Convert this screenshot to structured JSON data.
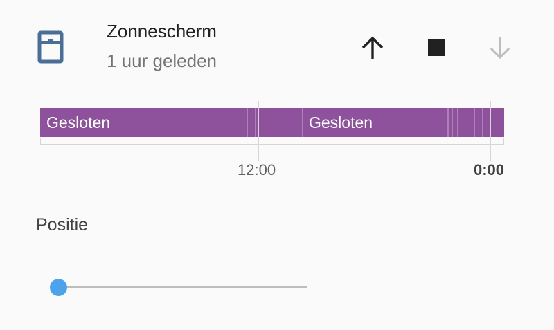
{
  "entity": {
    "name": "Zonnescherm",
    "last_changed": "1 uur geleden",
    "icon": "window-shutter-icon"
  },
  "controls": {
    "open": {
      "icon": "arrow-up-icon",
      "enabled": true
    },
    "stop": {
      "icon": "stop-icon",
      "enabled": true
    },
    "close": {
      "icon": "arrow-down-icon",
      "enabled": false
    }
  },
  "history": {
    "color": "#8e519b",
    "segments": [
      {
        "label": "Gesloten"
      },
      {
        "label": "Gesloten"
      }
    ],
    "axis": {
      "ticks": [
        {
          "label": "12:00",
          "bold": false
        },
        {
          "label": "0:00",
          "bold": true
        }
      ]
    }
  },
  "position": {
    "label": "Positie",
    "value": 0,
    "accent": "#4ca3ec"
  }
}
